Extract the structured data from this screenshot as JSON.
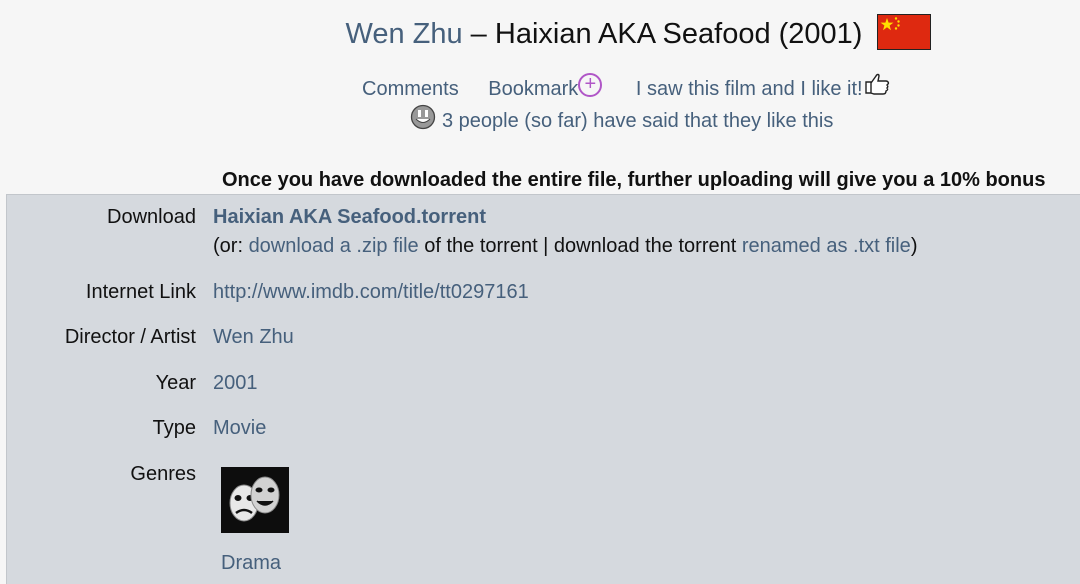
{
  "header": {
    "artist": "Wen Zhu",
    "separator": "–",
    "film": "Haixian AKA Seafood (2001)",
    "flag_icon": "china-flag-icon",
    "flag_colors": {
      "red": "#de2910",
      "yellow": "#ffde00"
    }
  },
  "actions": {
    "comments": "Comments",
    "bookmark": "Bookmark",
    "bookmark_icon": "plus-circle-icon",
    "like": "I saw this film and I like it!",
    "like_icon": "thumbs-up-icon",
    "likes_icon": "smiley-icon",
    "likes_text": "3 people (so far) have said that they like this"
  },
  "notice": "Once you have downloaded the entire file, further uploading will give you a 10% bonus",
  "details": {
    "download_label": "Download",
    "torrent_name": "Haixian AKA Seafood.torrent",
    "alt_prefix": "(or: ",
    "alt_zip": "download a .zip file",
    "alt_mid": " of the torrent | download the torrent ",
    "alt_txt": "renamed as .txt file",
    "alt_suffix": ")",
    "link_label": "Internet Link",
    "link_value": "http://www.imdb.com/title/tt0297161",
    "director_label": "Director / Artist",
    "director_value": "Wen Zhu",
    "year_label": "Year",
    "year_value": "2001",
    "type_label": "Type",
    "type_value": "Movie",
    "genres_label": "Genres",
    "genre_icon": "drama-masks-icon",
    "genre_value": "Drama"
  },
  "colors": {
    "link": "#46607c",
    "panel": "#d5d9de",
    "background": "#f6f6f6",
    "bookmark_accent": "#b056c7"
  }
}
